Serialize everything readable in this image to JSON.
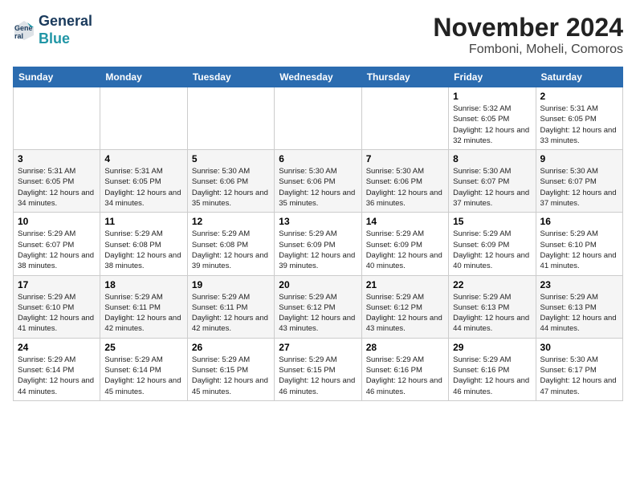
{
  "logo": {
    "line1": "General",
    "line2": "Blue"
  },
  "title": "November 2024",
  "subtitle": "Fomboni, Moheli, Comoros",
  "weekdays": [
    "Sunday",
    "Monday",
    "Tuesday",
    "Wednesday",
    "Thursday",
    "Friday",
    "Saturday"
  ],
  "weeks": [
    [
      {
        "day": "",
        "detail": ""
      },
      {
        "day": "",
        "detail": ""
      },
      {
        "day": "",
        "detail": ""
      },
      {
        "day": "",
        "detail": ""
      },
      {
        "day": "",
        "detail": ""
      },
      {
        "day": "1",
        "detail": "Sunrise: 5:32 AM\nSunset: 6:05 PM\nDaylight: 12 hours and 32 minutes."
      },
      {
        "day": "2",
        "detail": "Sunrise: 5:31 AM\nSunset: 6:05 PM\nDaylight: 12 hours and 33 minutes."
      }
    ],
    [
      {
        "day": "3",
        "detail": "Sunrise: 5:31 AM\nSunset: 6:05 PM\nDaylight: 12 hours and 34 minutes."
      },
      {
        "day": "4",
        "detail": "Sunrise: 5:31 AM\nSunset: 6:05 PM\nDaylight: 12 hours and 34 minutes."
      },
      {
        "day": "5",
        "detail": "Sunrise: 5:30 AM\nSunset: 6:06 PM\nDaylight: 12 hours and 35 minutes."
      },
      {
        "day": "6",
        "detail": "Sunrise: 5:30 AM\nSunset: 6:06 PM\nDaylight: 12 hours and 35 minutes."
      },
      {
        "day": "7",
        "detail": "Sunrise: 5:30 AM\nSunset: 6:06 PM\nDaylight: 12 hours and 36 minutes."
      },
      {
        "day": "8",
        "detail": "Sunrise: 5:30 AM\nSunset: 6:07 PM\nDaylight: 12 hours and 37 minutes."
      },
      {
        "day": "9",
        "detail": "Sunrise: 5:30 AM\nSunset: 6:07 PM\nDaylight: 12 hours and 37 minutes."
      }
    ],
    [
      {
        "day": "10",
        "detail": "Sunrise: 5:29 AM\nSunset: 6:07 PM\nDaylight: 12 hours and 38 minutes."
      },
      {
        "day": "11",
        "detail": "Sunrise: 5:29 AM\nSunset: 6:08 PM\nDaylight: 12 hours and 38 minutes."
      },
      {
        "day": "12",
        "detail": "Sunrise: 5:29 AM\nSunset: 6:08 PM\nDaylight: 12 hours and 39 minutes."
      },
      {
        "day": "13",
        "detail": "Sunrise: 5:29 AM\nSunset: 6:09 PM\nDaylight: 12 hours and 39 minutes."
      },
      {
        "day": "14",
        "detail": "Sunrise: 5:29 AM\nSunset: 6:09 PM\nDaylight: 12 hours and 40 minutes."
      },
      {
        "day": "15",
        "detail": "Sunrise: 5:29 AM\nSunset: 6:09 PM\nDaylight: 12 hours and 40 minutes."
      },
      {
        "day": "16",
        "detail": "Sunrise: 5:29 AM\nSunset: 6:10 PM\nDaylight: 12 hours and 41 minutes."
      }
    ],
    [
      {
        "day": "17",
        "detail": "Sunrise: 5:29 AM\nSunset: 6:10 PM\nDaylight: 12 hours and 41 minutes."
      },
      {
        "day": "18",
        "detail": "Sunrise: 5:29 AM\nSunset: 6:11 PM\nDaylight: 12 hours and 42 minutes."
      },
      {
        "day": "19",
        "detail": "Sunrise: 5:29 AM\nSunset: 6:11 PM\nDaylight: 12 hours and 42 minutes."
      },
      {
        "day": "20",
        "detail": "Sunrise: 5:29 AM\nSunset: 6:12 PM\nDaylight: 12 hours and 43 minutes."
      },
      {
        "day": "21",
        "detail": "Sunrise: 5:29 AM\nSunset: 6:12 PM\nDaylight: 12 hours and 43 minutes."
      },
      {
        "day": "22",
        "detail": "Sunrise: 5:29 AM\nSunset: 6:13 PM\nDaylight: 12 hours and 44 minutes."
      },
      {
        "day": "23",
        "detail": "Sunrise: 5:29 AM\nSunset: 6:13 PM\nDaylight: 12 hours and 44 minutes."
      }
    ],
    [
      {
        "day": "24",
        "detail": "Sunrise: 5:29 AM\nSunset: 6:14 PM\nDaylight: 12 hours and 44 minutes."
      },
      {
        "day": "25",
        "detail": "Sunrise: 5:29 AM\nSunset: 6:14 PM\nDaylight: 12 hours and 45 minutes."
      },
      {
        "day": "26",
        "detail": "Sunrise: 5:29 AM\nSunset: 6:15 PM\nDaylight: 12 hours and 45 minutes."
      },
      {
        "day": "27",
        "detail": "Sunrise: 5:29 AM\nSunset: 6:15 PM\nDaylight: 12 hours and 46 minutes."
      },
      {
        "day": "28",
        "detail": "Sunrise: 5:29 AM\nSunset: 6:16 PM\nDaylight: 12 hours and 46 minutes."
      },
      {
        "day": "29",
        "detail": "Sunrise: 5:29 AM\nSunset: 6:16 PM\nDaylight: 12 hours and 46 minutes."
      },
      {
        "day": "30",
        "detail": "Sunrise: 5:30 AM\nSunset: 6:17 PM\nDaylight: 12 hours and 47 minutes."
      }
    ]
  ]
}
